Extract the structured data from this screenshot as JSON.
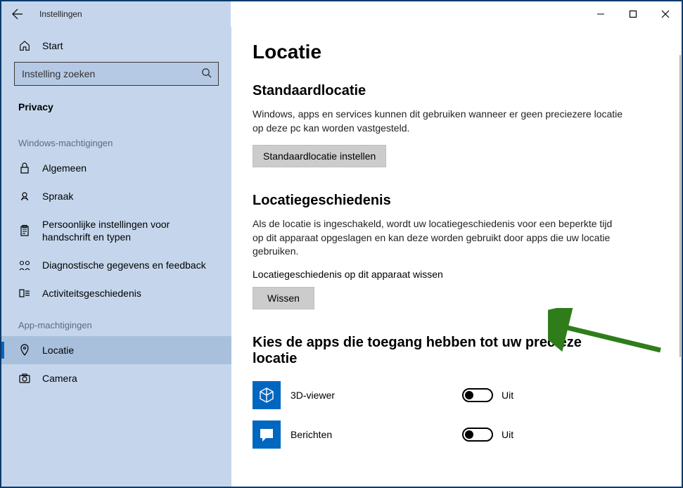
{
  "window": {
    "title": "Instellingen"
  },
  "sidebar": {
    "home": "Start",
    "search_placeholder": "Instelling zoeken",
    "current_section": "Privacy",
    "group1_heading": "Windows-machtigingen",
    "group1": [
      {
        "label": "Algemeen"
      },
      {
        "label": "Spraak"
      },
      {
        "label": "Persoonlijke instellingen voor handschrift en typen"
      },
      {
        "label": "Diagnostische gegevens en feedback"
      },
      {
        "label": "Activiteitsgeschiedenis"
      }
    ],
    "group2_heading": "App-machtigingen",
    "group2": [
      {
        "label": "Locatie",
        "selected": true
      },
      {
        "label": "Camera"
      }
    ]
  },
  "content": {
    "page_title": "Locatie",
    "section1": {
      "title": "Standaardlocatie",
      "desc": "Windows, apps en services kunnen dit gebruiken wanneer er geen preciezere locatie op deze pc kan worden vastgesteld.",
      "button": "Standaardlocatie instellen"
    },
    "section2": {
      "title": "Locatiegeschiedenis",
      "desc": "Als de locatie is ingeschakeld, wordt uw locatiegeschiedenis voor een beperkte tijd op dit apparaat opgeslagen en kan deze worden gebruikt door apps die uw locatie gebruiken.",
      "sublabel": "Locatiegeschiedenis op dit apparaat wissen",
      "button": "Wissen"
    },
    "section3": {
      "title": "Kies de apps die toegang hebben tot uw precieze locatie",
      "apps": [
        {
          "name": "3D-viewer",
          "state": "Uit"
        },
        {
          "name": "Berichten",
          "state": "Uit"
        }
      ]
    }
  }
}
